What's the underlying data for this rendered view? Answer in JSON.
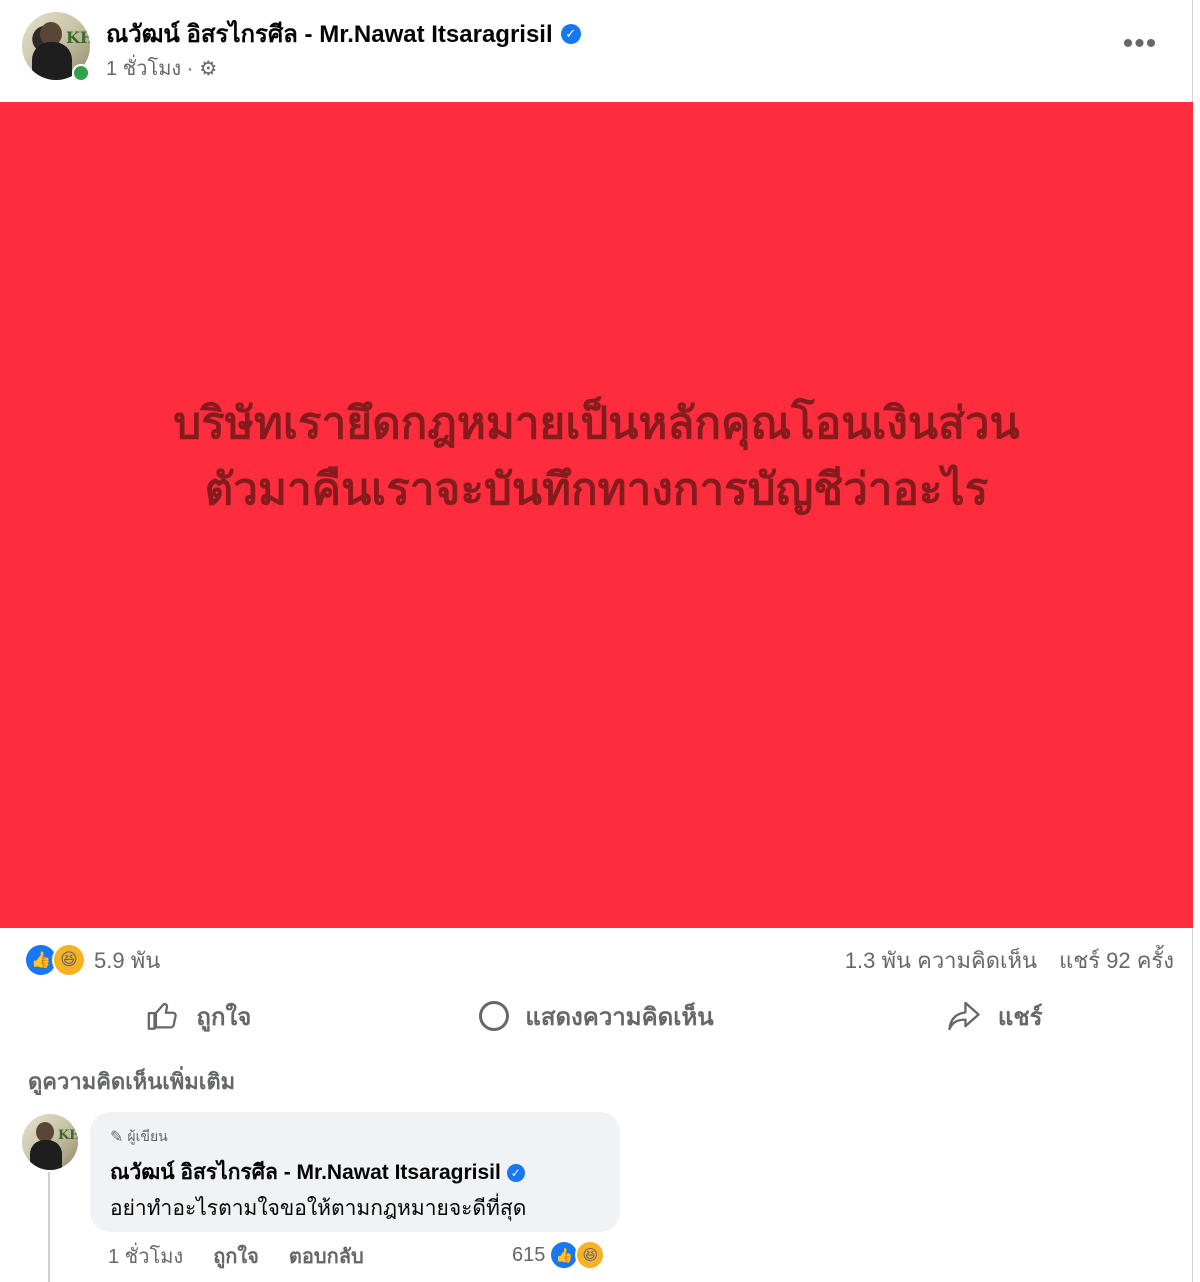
{
  "post": {
    "author_name": "ณวัฒน์ อิสรไกรศีล - Mr.Nawat Itsaragrisil",
    "time": "1 ชั่วโมง ·",
    "avatar_logo": "KH",
    "image_text_line1": "บริษัทเรายึดกฎหมายเป็นหลักคุณโอนเงินส่วน",
    "image_text_line2": "ตัวมาคืนเราจะบันทึกทางการบัญชีว่าอะไร",
    "image_background": "#fe2d3e",
    "image_text_color": "#851b1d"
  },
  "stats": {
    "reaction_count": "5.9 พัน",
    "comments": "1.3 พัน ความคิดเห็น",
    "shares": "แชร์ 92 ครั้ง"
  },
  "actions": {
    "like_label": "ถูกใจ",
    "comment_label": "แสดงความคิดเห็น",
    "share_label": "แชร์"
  },
  "comments_section": {
    "more_comments_label": "ดูความคิดเห็นเพิ่มเติม"
  },
  "comment": {
    "badge": "ผู้เขียน",
    "author": "ณวัฒน์ อิสรไกรศีล - Mr.Nawat Itsaragrisil",
    "text": "อย่าทำอะไรตามใจขอให้ตามกฎหมายจะดีที่สุด",
    "time": "1 ชั่วโมง",
    "like_label": "ถูกใจ",
    "reply_label": "ตอบกลับ",
    "reaction_count": "615"
  },
  "icons": {
    "verified": "verified-badge-icon",
    "privacy": "gear-icon",
    "more": "more-options-icon",
    "like": "thumbs-up-icon",
    "haha": "laughing-face-icon",
    "comment": "comment-bubble-icon",
    "share": "share-arrow-icon",
    "pencil": "pencil-icon"
  },
  "colors": {
    "accent": "#1877f2",
    "secondary_text": "#65676b",
    "online": "#31a24c"
  }
}
